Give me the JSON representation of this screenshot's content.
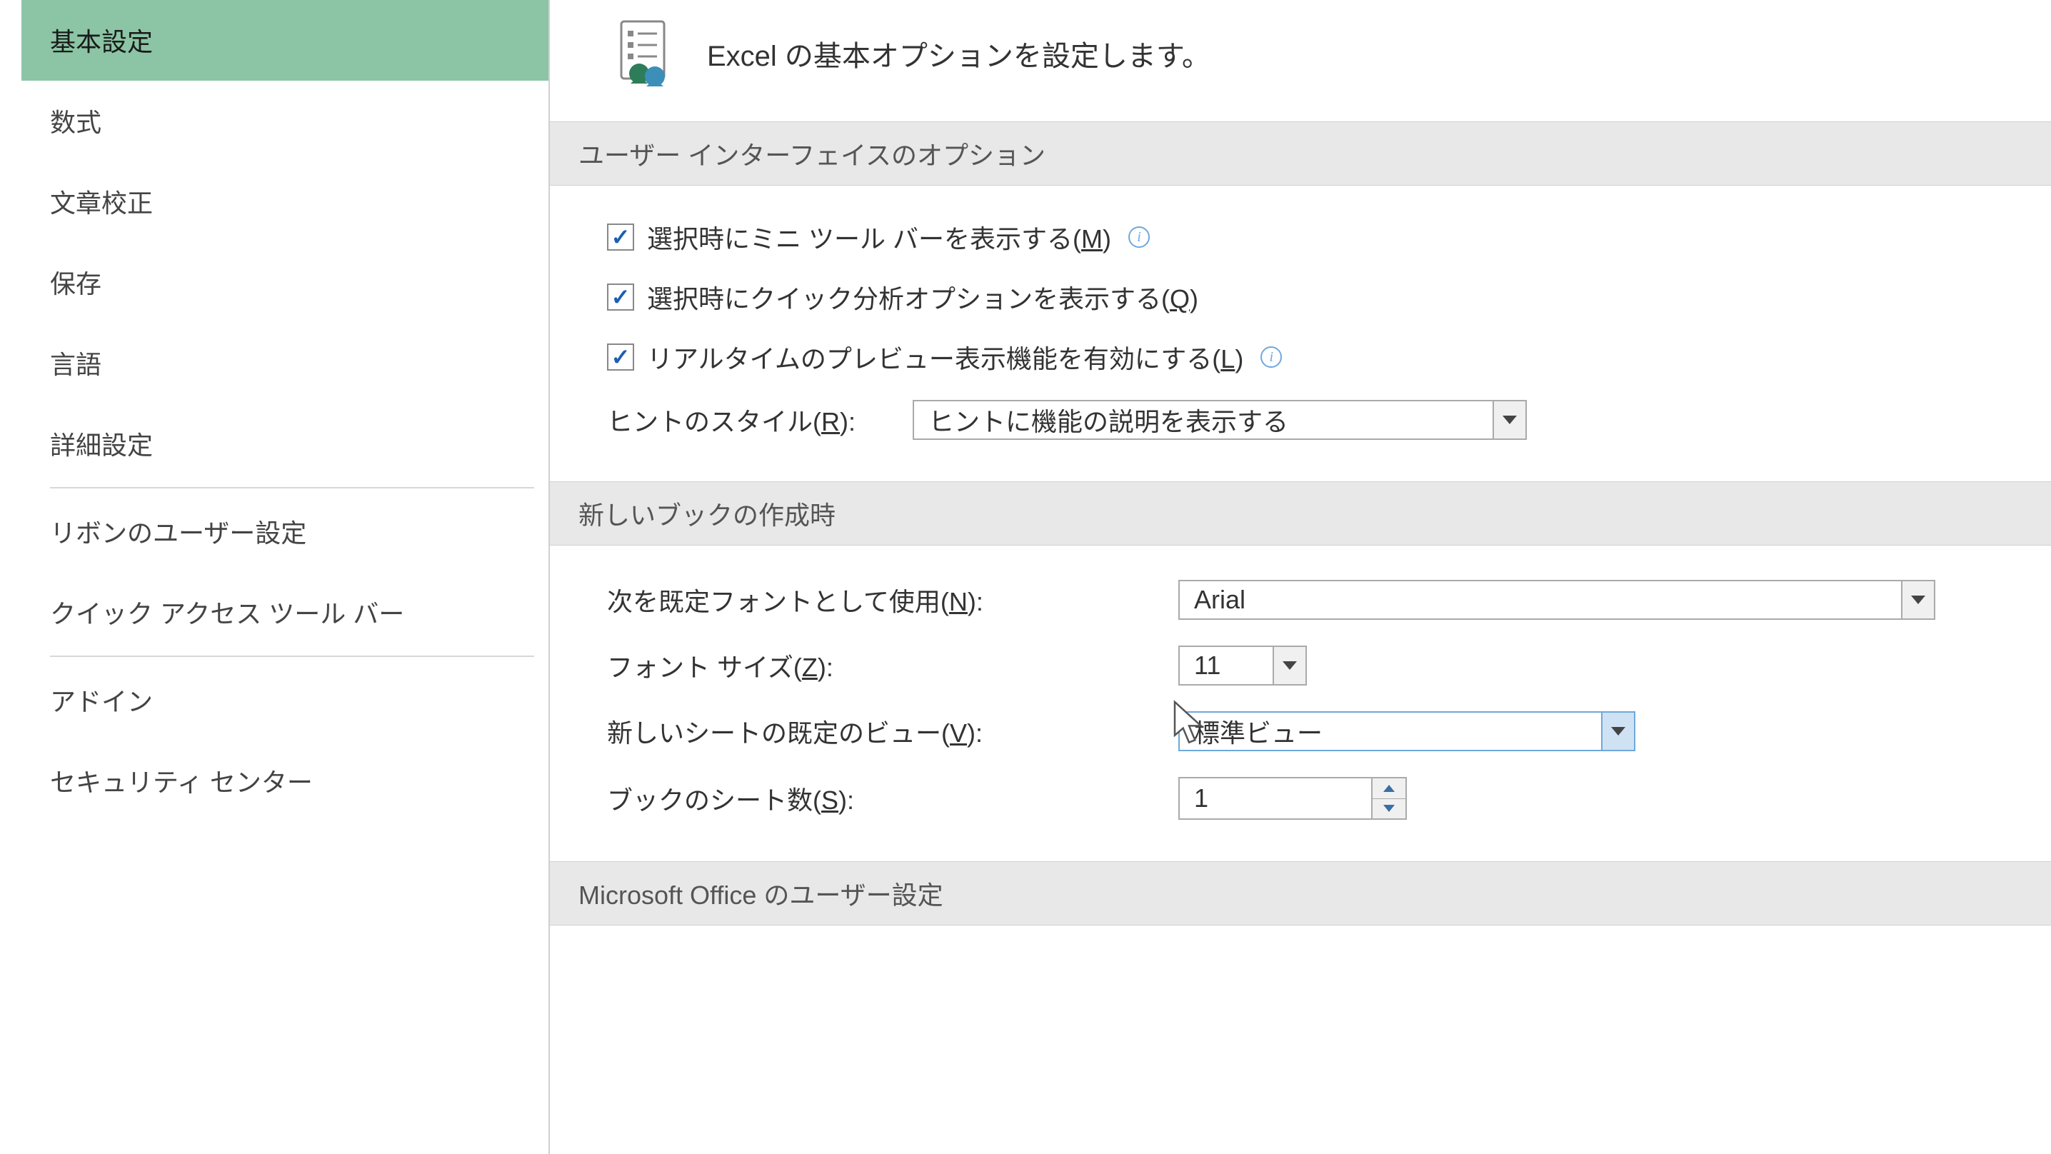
{
  "sidebar": {
    "items": [
      {
        "label": "基本設定",
        "selected": true
      },
      {
        "label": "数式",
        "selected": false
      },
      {
        "label": "文章校正",
        "selected": false
      },
      {
        "label": "保存",
        "selected": false
      },
      {
        "label": "言語",
        "selected": false
      },
      {
        "label": "詳細設定",
        "selected": false
      }
    ],
    "items2": [
      {
        "label": "リボンのユーザー設定",
        "selected": false
      },
      {
        "label": "クイック アクセス ツール バー",
        "selected": false
      }
    ],
    "items3": [
      {
        "label": "アドイン",
        "selected": false
      },
      {
        "label": "セキュリティ センター",
        "selected": false
      }
    ]
  },
  "header": {
    "title": "Excel の基本オプションを設定します。"
  },
  "section1": {
    "title": "ユーザー インターフェイスのオプション",
    "opt1_pre": "選択時にミニ ツール バーを表示する(",
    "opt1_u": "M",
    "opt1_post": ")",
    "opt2_pre": "選択時にクイック分析オプションを表示する(",
    "opt2_u": "Q",
    "opt2_post": ")",
    "opt3_pre": "リアルタイムのプレビュー表示機能を有効にする(",
    "opt3_u": "L",
    "opt3_post": ")",
    "hint_label_pre": "ヒントのスタイル(",
    "hint_label_u": "R",
    "hint_label_post": "):",
    "hint_value": "ヒントに機能の説明を表示する"
  },
  "section2": {
    "title": "新しいブックの作成時",
    "font_label_pre": "次を既定フォントとして使用(",
    "font_label_u": "N",
    "font_label_post": "):",
    "font_value": "Arial",
    "size_label_pre": "フォント サイズ(",
    "size_label_u": "Z",
    "size_label_post": "):",
    "size_value": "11",
    "view_label_pre": "新しいシートの既定のビュー(",
    "view_label_u": "V",
    "view_label_post": "):",
    "view_value": "標準ビュー",
    "sheets_label_pre": "ブックのシート数(",
    "sheets_label_u": "S",
    "sheets_label_post": "):",
    "sheets_value": "1"
  },
  "section3": {
    "title": "Microsoft Office のユーザー設定"
  }
}
